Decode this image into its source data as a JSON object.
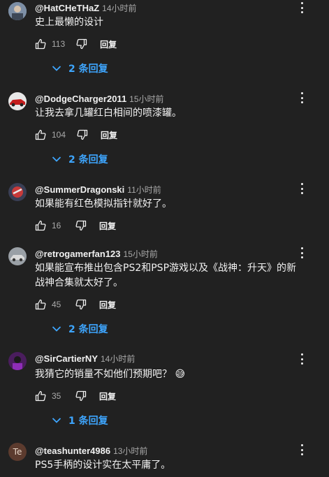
{
  "common": {
    "reply_label": "回复"
  },
  "comments": [
    {
      "username": "@HatCHeTHaZ",
      "time": "14小时前",
      "text": "史上最懒的设计",
      "likes": "113",
      "replies_label": "2 条回复"
    },
    {
      "username": "@DodgeCharger2011",
      "time": "15小时前",
      "text": "让我去拿几罐红白相间的喷漆罐。",
      "likes": "104",
      "replies_label": "2 条回复"
    },
    {
      "username": "@SummerDragonski",
      "time": "11小时前",
      "text": "如果能有红色模拟指针就好了。",
      "likes": "16"
    },
    {
      "username": "@retrogamerfan123",
      "time": "15小时前",
      "text": "如果能宣布推出包含PS2和PSP游戏以及《战神：升天》的新战神合集就太好了。",
      "likes": "45",
      "replies_label": "2 条回复"
    },
    {
      "username": "@SirCartierNY",
      "time": "14小时前",
      "text": "我猜它的销量不如他们预期吧？",
      "emoji": "😅",
      "likes": "35",
      "replies_label": "1 条回复"
    },
    {
      "username": "@teashunter4986",
      "time": "13小时前",
      "text": "PS5手柄的设计实在太平庸了。",
      "avatar_text": "Te"
    }
  ]
}
